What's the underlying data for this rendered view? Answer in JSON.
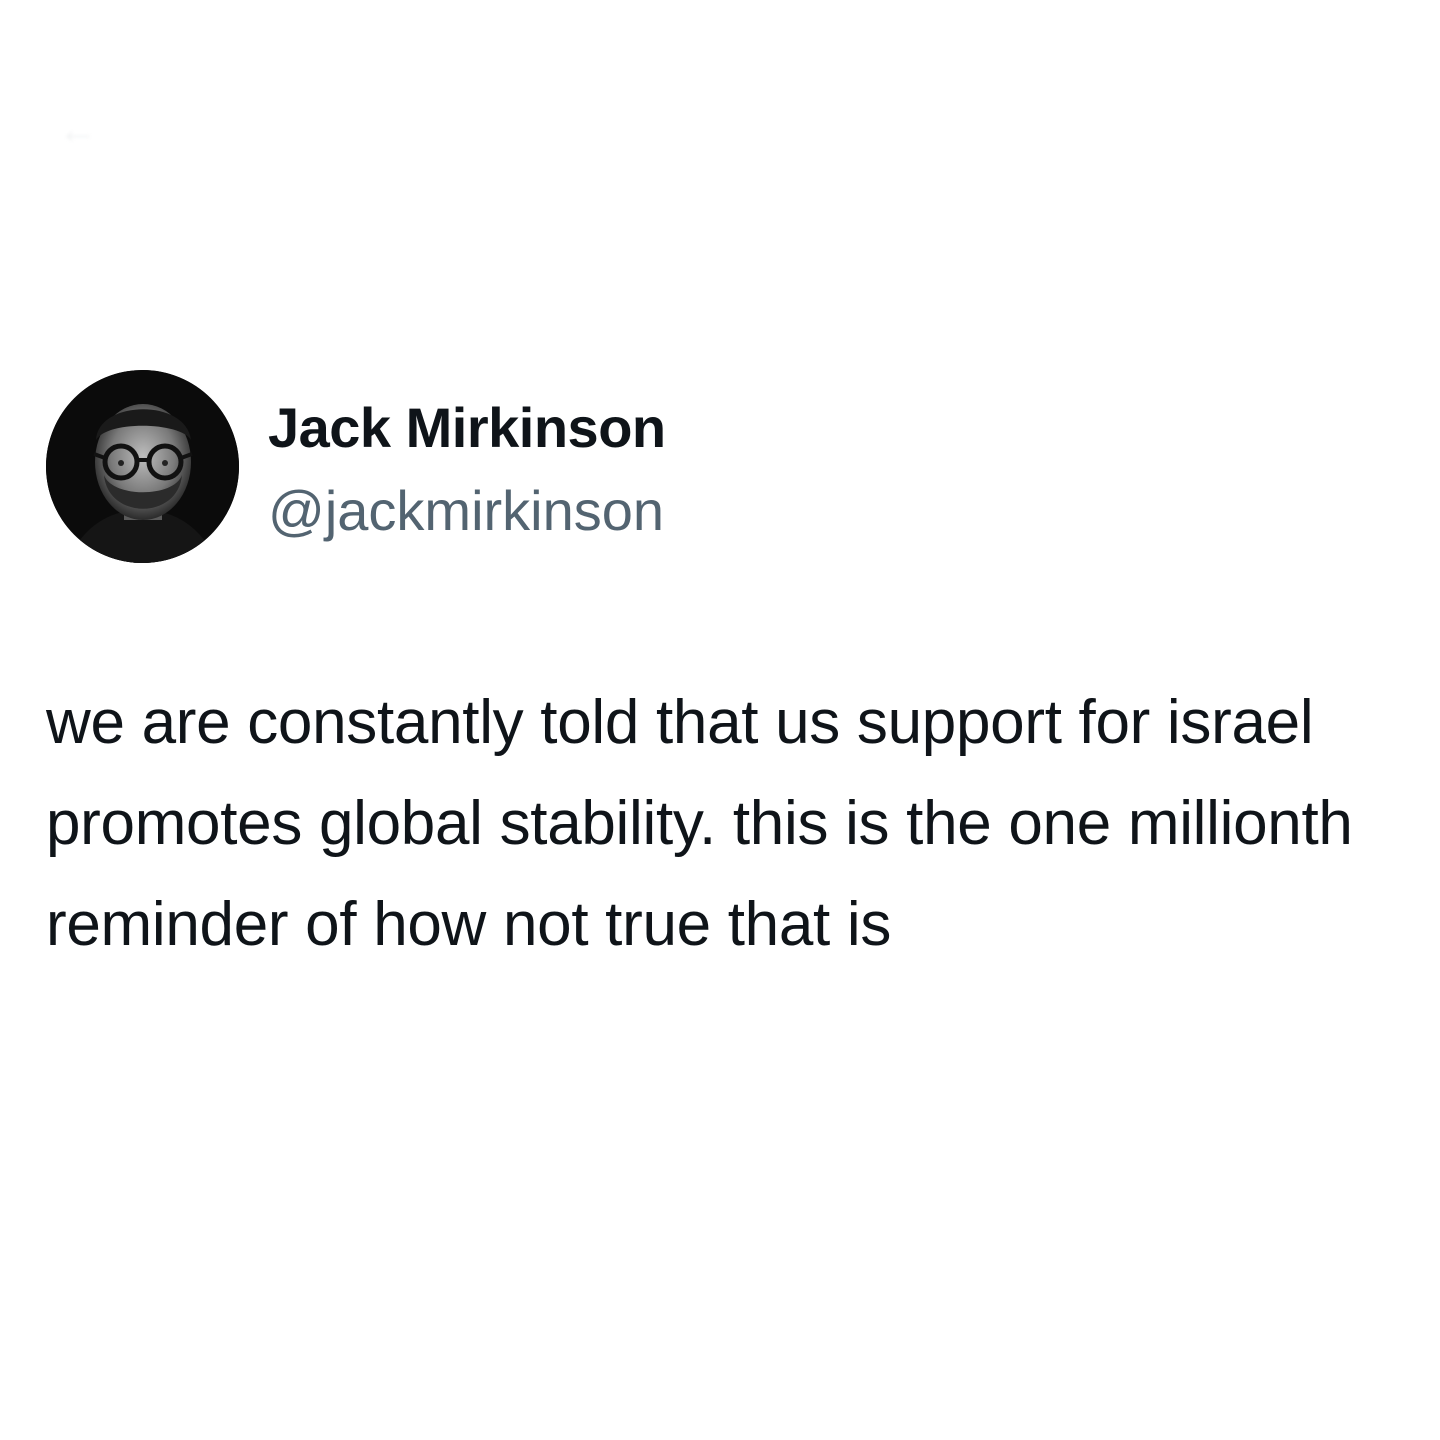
{
  "author": {
    "display_name": "Jack Mirkinson",
    "handle": "@jackmirkinson",
    "avatar_icon": "profile-photo"
  },
  "tweet": {
    "text": "we are constantly told that us support for israel promotes global stability. this is the one millionth reminder of how not true that is"
  },
  "colors": {
    "background": "#ffffff",
    "primary_text": "#0f1419",
    "secondary_text": "#536471"
  }
}
